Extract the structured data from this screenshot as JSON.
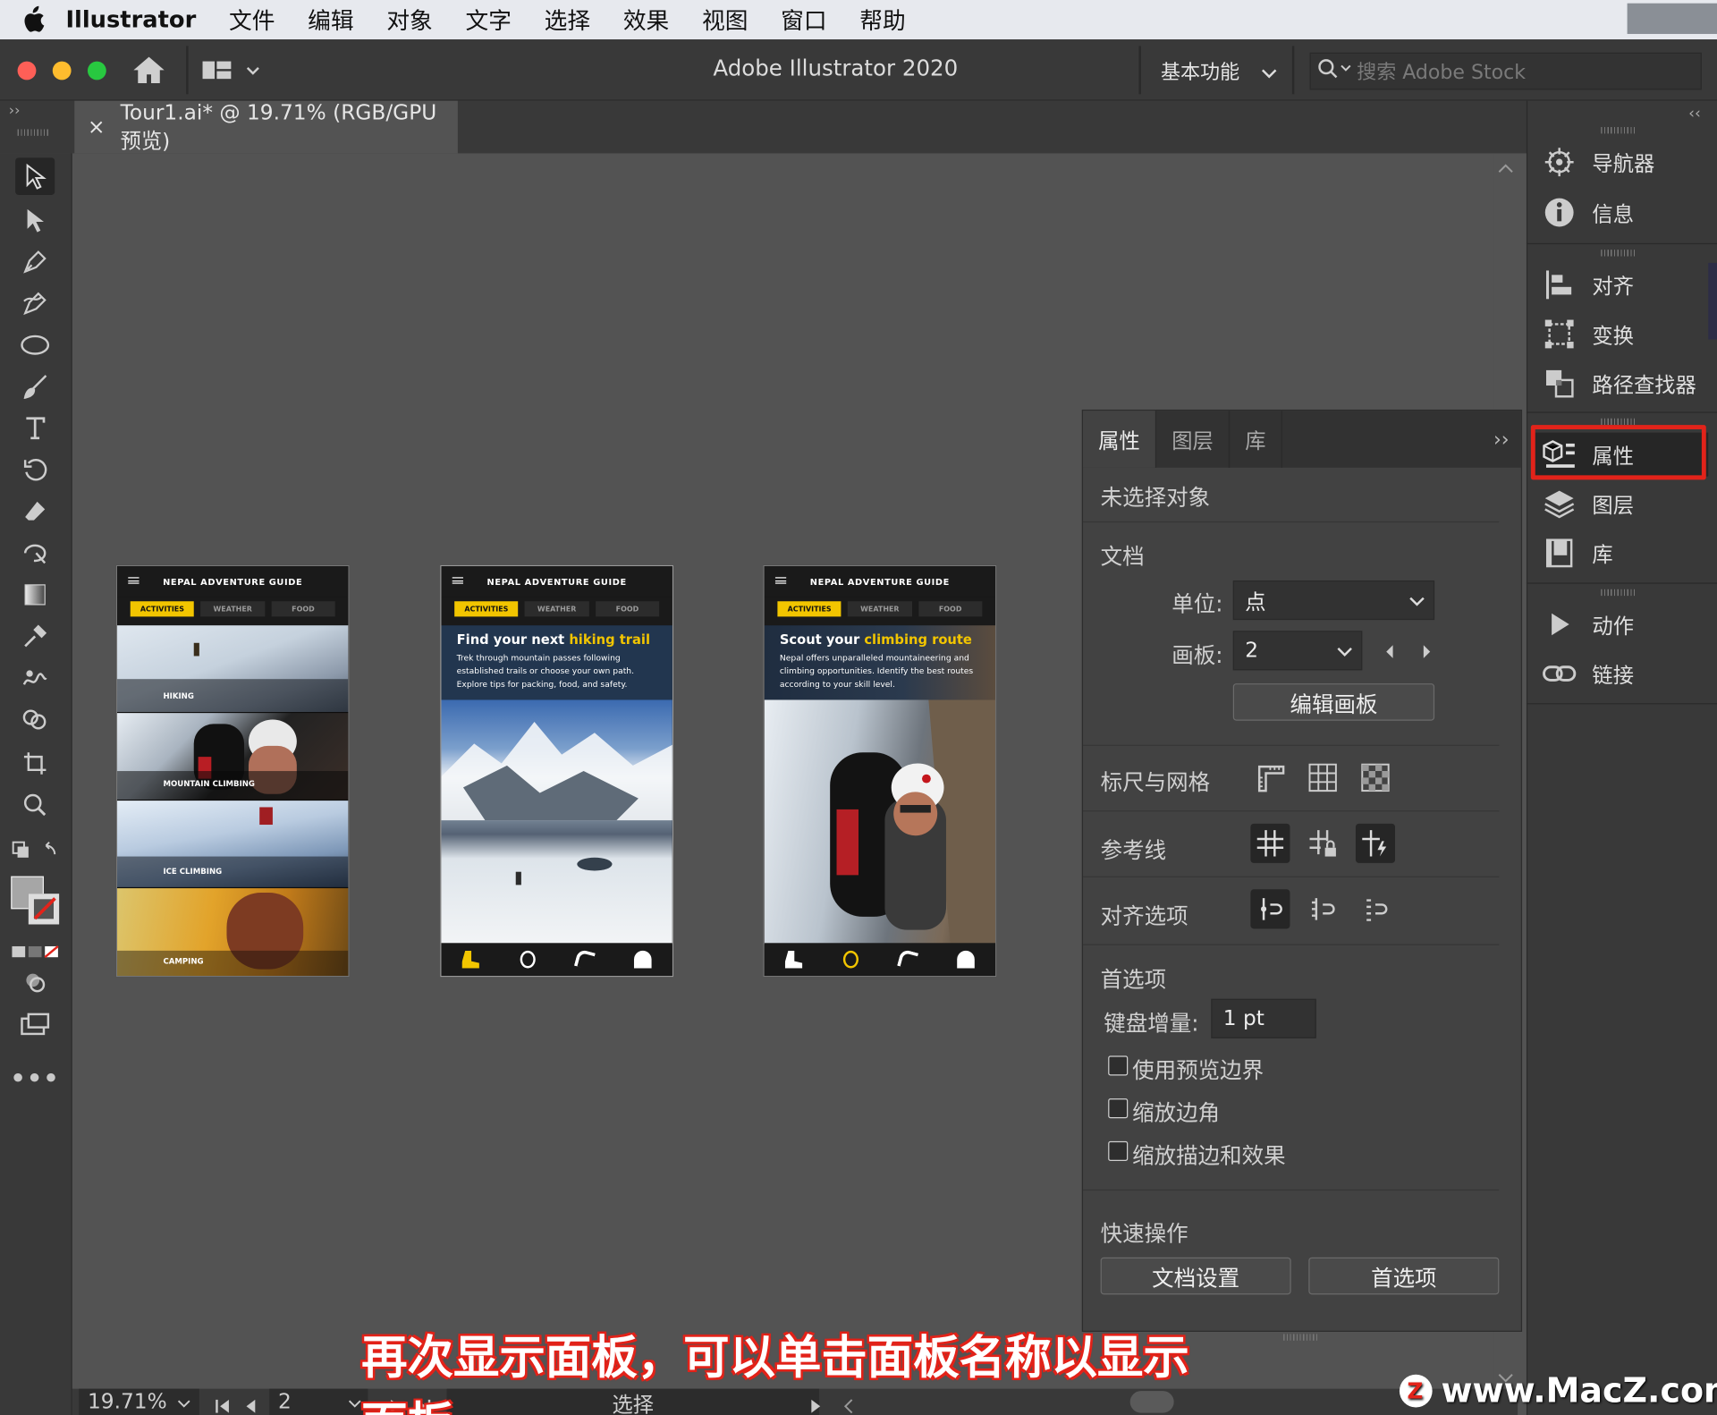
{
  "menubar": {
    "app_name": "Illustrator",
    "items": [
      "文件",
      "编辑",
      "对象",
      "文字",
      "选择",
      "效果",
      "视图",
      "窗口",
      "帮助"
    ]
  },
  "window": {
    "title": "Adobe Illustrator 2020",
    "workspace": "基本功能",
    "search_placeholder": "搜索 Adobe Stock"
  },
  "document_tab": {
    "close": "×",
    "label": "Tour1.ai* @ 19.71% (RGB/GPU 预览)"
  },
  "artboards": [
    {
      "header": "NEPAL ADVENTURE GUIDE",
      "tabs": [
        "ACTIVITIES",
        "WEATHER",
        "FOOD"
      ],
      "strips": [
        "HIKING",
        "MOUNTAIN CLIMBING",
        "ICE CLIMBING",
        "CAMPING"
      ]
    },
    {
      "header": "NEPAL ADVENTURE GUIDE",
      "tabs": [
        "ACTIVITIES",
        "WEATHER",
        "FOOD"
      ],
      "promo_title_a": "Find your next ",
      "promo_title_b": "hiking trail",
      "promo_text": "Trek through mountain passes following established trails or choose your own path. Explore tips for packing, food, and safety."
    },
    {
      "header": "NEPAL ADVENTURE GUIDE",
      "tabs": [
        "ACTIVITIES",
        "WEATHER",
        "FOOD"
      ],
      "promo_title_a": "Scout your ",
      "promo_title_b": "climbing route",
      "promo_text": "Nepal offers unparalleled mountaineering and climbing opportunities. Identify the best routes according to your skill level."
    }
  ],
  "properties_panel": {
    "tabs": [
      "属性",
      "图层",
      "库"
    ],
    "active_tab": "属性",
    "no_selection": "未选择对象",
    "document_label": "文档",
    "units_label": "单位:",
    "units_value": "点",
    "artboard_label": "画板:",
    "artboard_value": "2",
    "edit_artboards": "编辑画板",
    "rulers_grids": "标尺与网格",
    "guides": "参考线",
    "snap_options": "对齐选项",
    "preferences": "首选项",
    "keyboard_increment_label": "键盘增量:",
    "keyboard_increment_value": "1 pt",
    "checkboxes": [
      "使用预览边界",
      "缩放边角",
      "缩放描边和效果"
    ],
    "quick_actions": "快速操作",
    "doc_setup_button": "文档设置",
    "prefs_button": "首选项"
  },
  "dock": {
    "groups": [
      [
        "导航器",
        "信息"
      ],
      [
        "对齐",
        "变换",
        "路径查找器"
      ],
      [
        "属性",
        "图层",
        "库"
      ],
      [
        "动作",
        "链接"
      ]
    ],
    "highlight": "属性",
    "highlight_color": "#e2231a"
  },
  "statusbar": {
    "zoom": "19.71%",
    "artboard": "2",
    "mode": "选择"
  },
  "subtitle": "再次显示面板，可以单击面板名称以显示面板",
  "watermark": "www.MacZ.com"
}
